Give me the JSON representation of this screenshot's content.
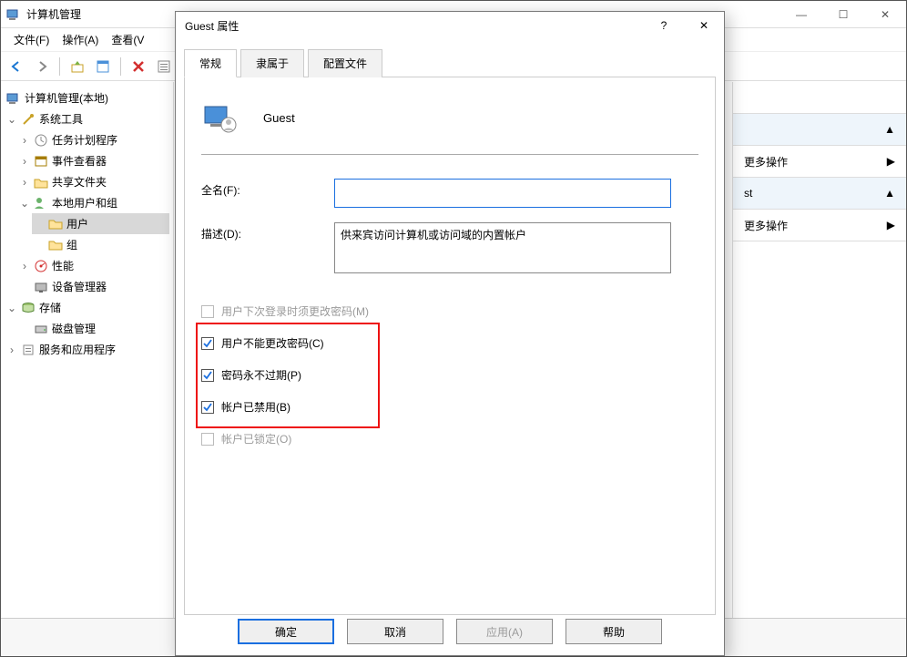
{
  "mainWindow": {
    "title": "计算机管理",
    "menu": {
      "file": "文件(F)",
      "action": "操作(A)",
      "view": "查看(V"
    },
    "winButtons": {
      "min": "—",
      "max": "☐",
      "close": "✕"
    }
  },
  "tree": {
    "root": "计算机管理(本地)",
    "systemTools": "系统工具",
    "taskScheduler": "任务计划程序",
    "eventViewer": "事件查看器",
    "sharedFolders": "共享文件夹",
    "localUsersGroups": "本地用户和组",
    "users": "用户",
    "groups": "组",
    "performance": "性能",
    "deviceManager": "设备管理器",
    "storage": "存储",
    "diskManagement": "磁盘管理",
    "servicesApps": "服务和应用程序"
  },
  "actionsPane": {
    "moreActions": "更多操作",
    "stSuffix": "st"
  },
  "dialog": {
    "title": "Guest 属性",
    "help": "?",
    "close": "✕",
    "tabs": {
      "general": "常规",
      "memberOf": "隶属于",
      "profile": "配置文件"
    },
    "userName": "Guest",
    "fullNameLabel": "全名(F):",
    "fullNameValue": "",
    "descLabel": "描述(D):",
    "descValue": "供来宾访问计算机或访问域的内置帐户",
    "checks": {
      "mustChange": "用户下次登录时须更改密码(M)",
      "cannotChange": "用户不能更改密码(C)",
      "neverExpires": "密码永不过期(P)",
      "disabled": "帐户已禁用(B)",
      "locked": "帐户已锁定(O)"
    },
    "buttons": {
      "ok": "确定",
      "cancel": "取消",
      "apply": "应用(A)",
      "help": "帮助"
    }
  }
}
